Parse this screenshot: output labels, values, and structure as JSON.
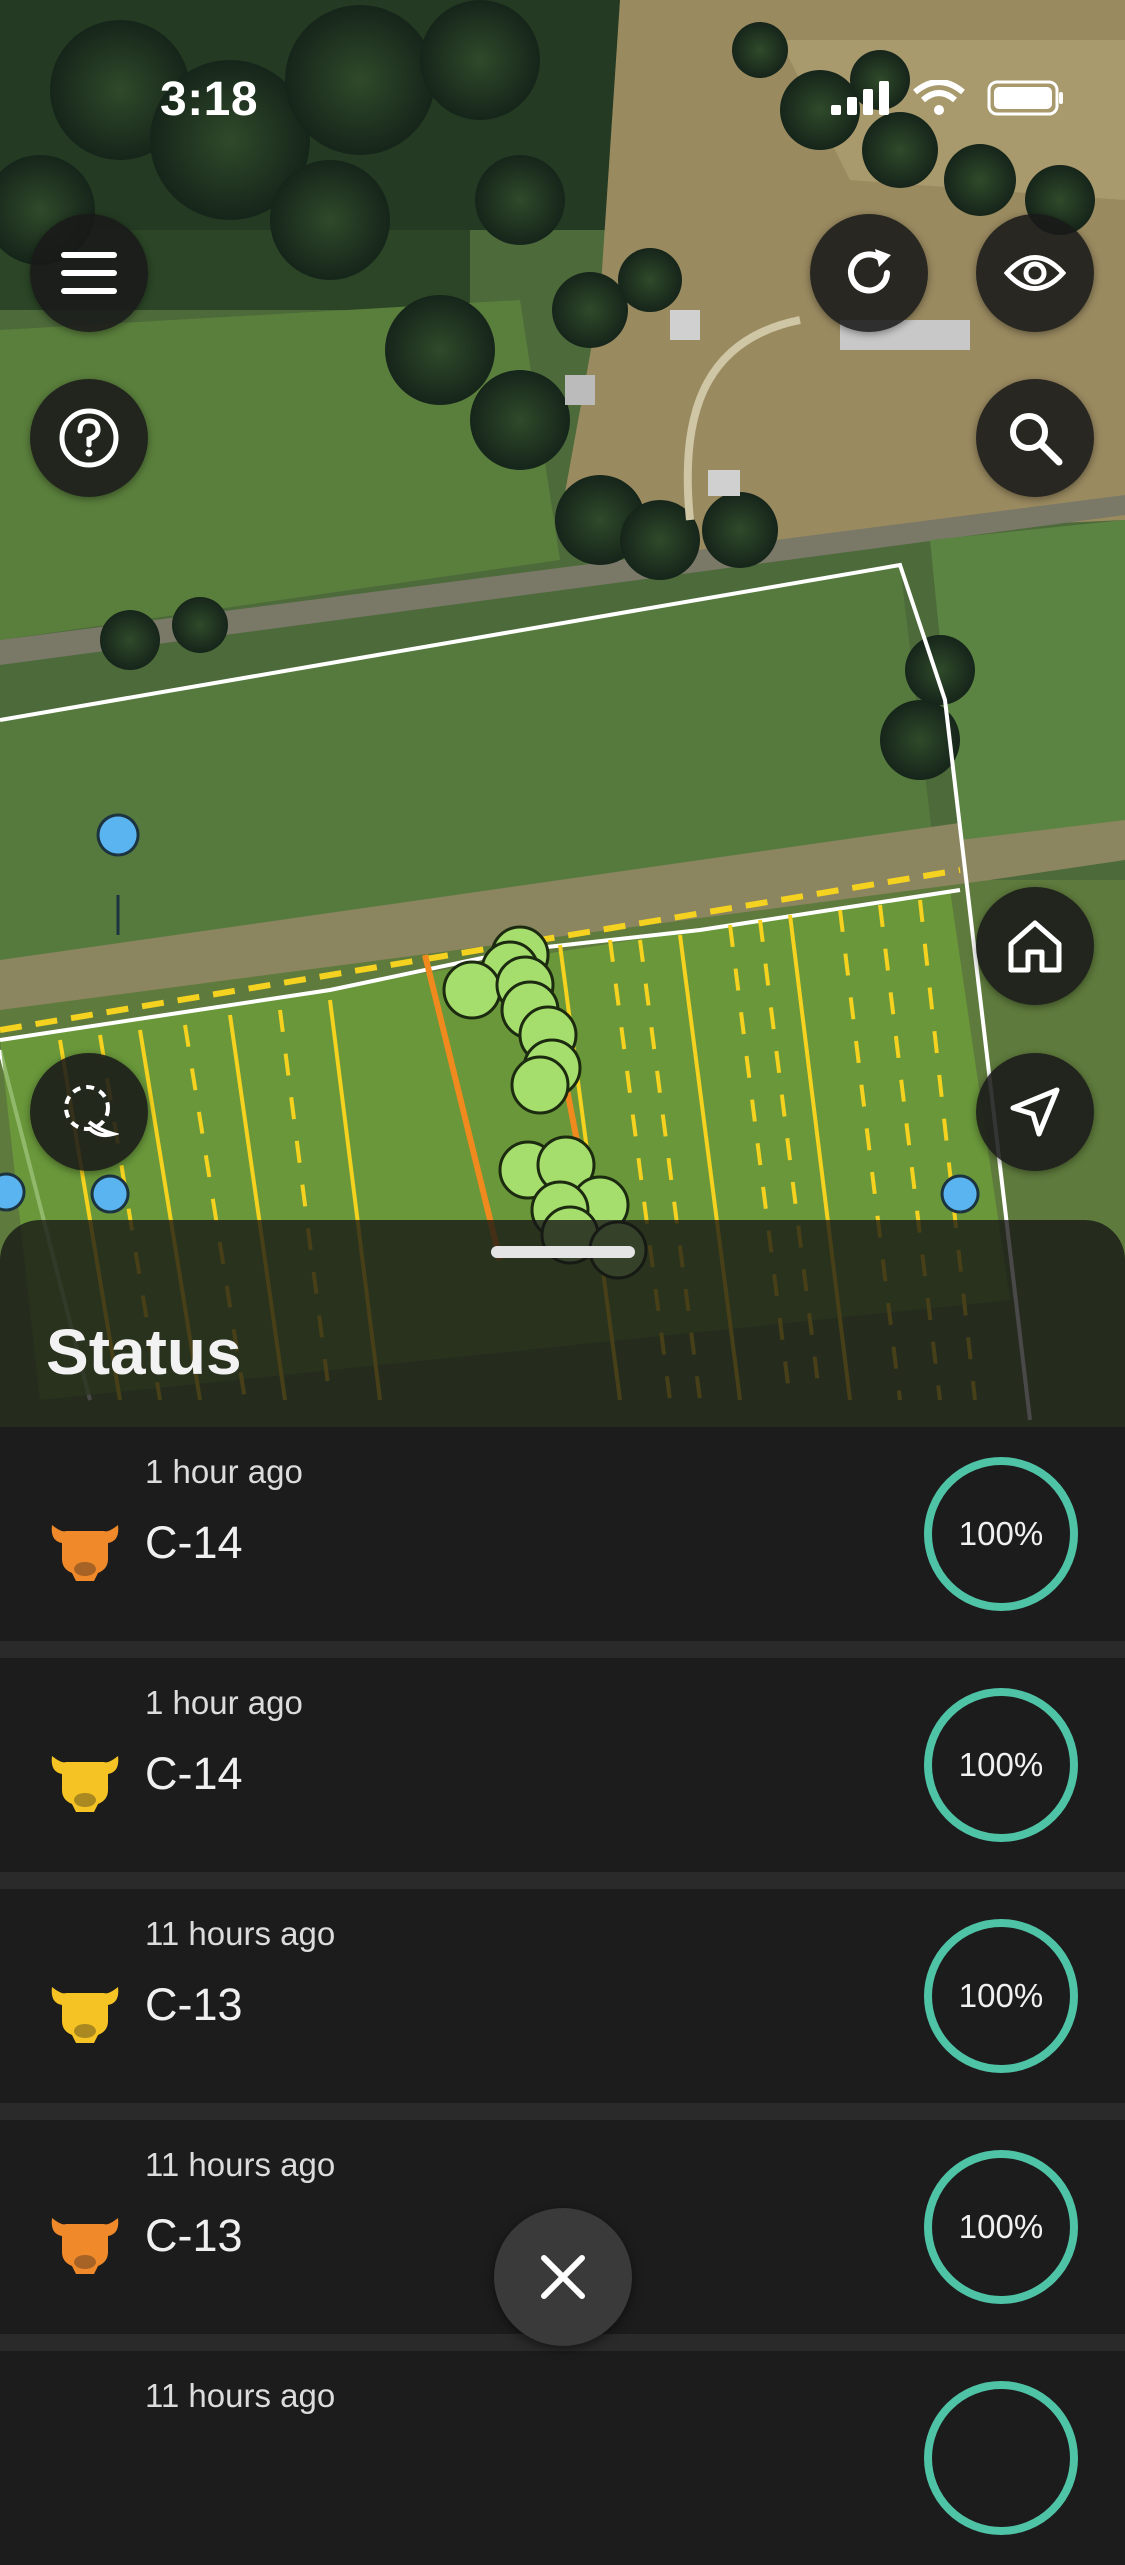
{
  "status_bar": {
    "time": "3:18"
  },
  "map": {
    "buttons": [
      {
        "name": "menu-button",
        "icon": "hamburger-icon"
      },
      {
        "name": "help-button",
        "icon": "help-circle-icon"
      },
      {
        "name": "refresh-button",
        "icon": "refresh-icon"
      },
      {
        "name": "visibility-button",
        "icon": "eye-icon"
      },
      {
        "name": "search-button",
        "icon": "search-icon"
      },
      {
        "name": "home-button",
        "icon": "home-icon"
      },
      {
        "name": "locate-button",
        "icon": "navigation-arrow-icon"
      },
      {
        "name": "lasso-select-button",
        "icon": "lasso-icon"
      }
    ],
    "colors": {
      "field_boundary": "#ffffff",
      "fence_line": "#f5d21f",
      "active_fence": "#f08a1e",
      "animal_marker": "#a6de6e",
      "water_marker": "#5ab4f0"
    }
  },
  "sheet": {
    "title": "Status",
    "rows": [
      {
        "time": "1 hour ago",
        "name": "C-14",
        "percent": "100%",
        "progress": 1.0,
        "cow_color": "#f0892a"
      },
      {
        "time": "1 hour ago",
        "name": "C-14",
        "percent": "100%",
        "progress": 1.0,
        "cow_color": "#f5c323"
      },
      {
        "time": "11 hours ago",
        "name": "C-13",
        "percent": "100%",
        "progress": 1.0,
        "cow_color": "#f5c323"
      },
      {
        "time": "11 hours ago",
        "name": "C-13",
        "percent": "100%",
        "progress": 1.0,
        "cow_color": "#f0892a"
      },
      {
        "time": "11 hours ago",
        "name": "",
        "percent": "",
        "progress": 1.0,
        "cow_color": "#f5c323"
      }
    ],
    "ring_color": "#4fc3a6"
  }
}
